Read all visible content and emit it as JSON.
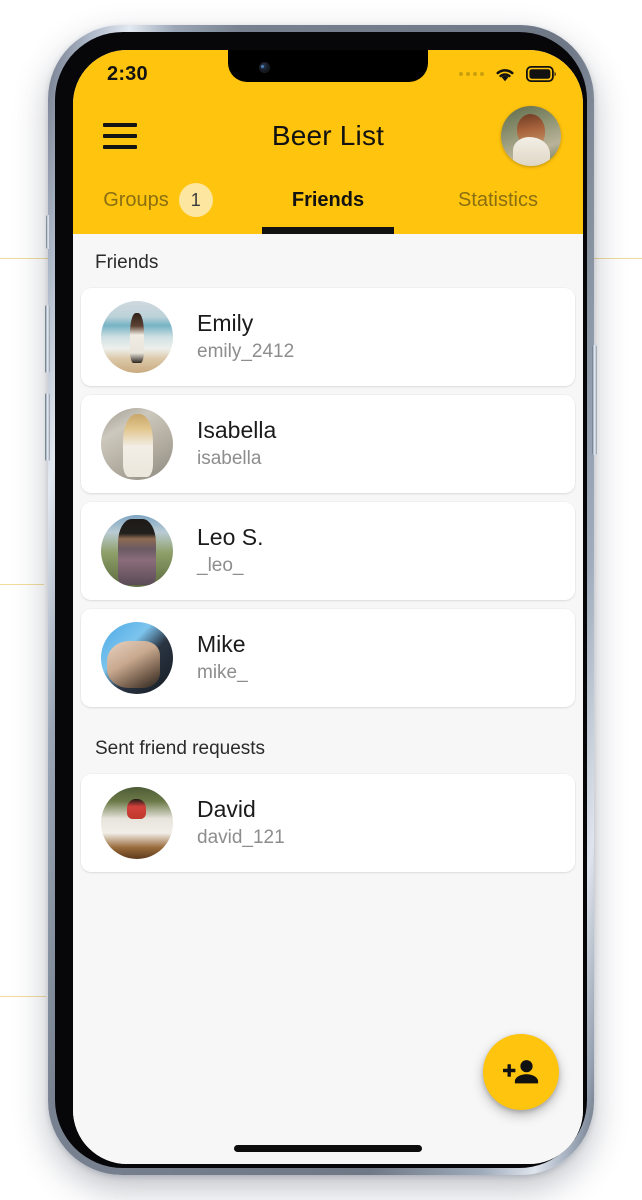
{
  "status_bar": {
    "time": "2:30",
    "signal_icon": "signal-dots-icon",
    "wifi_icon": "wifi-icon",
    "battery_icon": "battery-full-icon"
  },
  "app_bar": {
    "menu_icon": "hamburger-menu-icon",
    "title": "Beer List",
    "avatar_icon": "profile-avatar"
  },
  "tabs": [
    {
      "label": "Groups",
      "badge": "1",
      "active": false
    },
    {
      "label": "Friends",
      "badge": null,
      "active": true
    },
    {
      "label": "Statistics",
      "badge": null,
      "active": false
    }
  ],
  "sections": [
    {
      "header": "Friends",
      "items": [
        {
          "name": "Emily",
          "username": "emily_2412"
        },
        {
          "name": "Isabella",
          "username": "isabella"
        },
        {
          "name": "Leo S.",
          "username": "_leo_"
        },
        {
          "name": "Mike",
          "username": "mike_"
        }
      ]
    },
    {
      "header": "Sent friend requests",
      "items": [
        {
          "name": "David",
          "username": "david_121"
        }
      ]
    }
  ],
  "fab": {
    "icon": "person-add-icon",
    "color": "#FFC40D"
  },
  "colors": {
    "accent": "#FFC40D",
    "badge": "#FCE6A0",
    "background": "#F7F7F7",
    "card": "#FFFFFF",
    "primary_text": "#1B1B1B",
    "secondary_text": "#8D8D8D",
    "inactive_tab_text": "#8A6F12"
  }
}
